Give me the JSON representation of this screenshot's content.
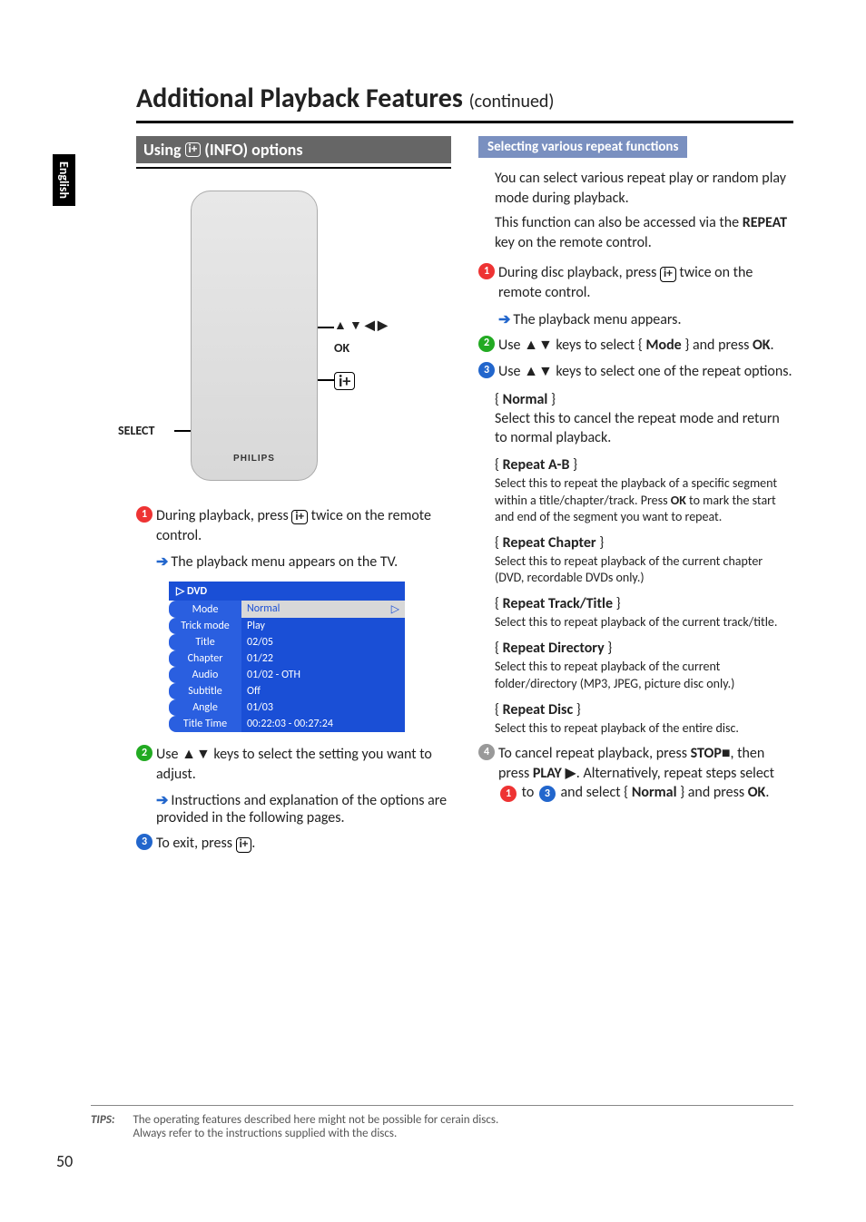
{
  "side_tab": "English",
  "title_main": "Additional Playback Features ",
  "title_cont": "(continued)",
  "left": {
    "section_title": "Using ",
    "section_title_suffix": "(INFO) options",
    "remote_labels": {
      "arrows": "▲ ▼ ◀ ▶",
      "ok": "OK",
      "select": "SELECT"
    },
    "step1": "During playback, press ",
    "step1b": " twice on the remote control.",
    "step1_sub": "The playback menu appears on the TV.",
    "menu_header": "DVD",
    "menu_rows": [
      {
        "label": "Mode",
        "value": "Normal",
        "hi": false,
        "cursor": true
      },
      {
        "label": "Trick mode",
        "value": "Play",
        "hi": true
      },
      {
        "label": "Title",
        "value": "02/05",
        "hi": true
      },
      {
        "label": "Chapter",
        "value": "01/22",
        "hi": true
      },
      {
        "label": "Audio",
        "value": "01/02 - OTH",
        "hi": true
      },
      {
        "label": "Subtitle",
        "value": "Off",
        "hi": true
      },
      {
        "label": "Angle",
        "value": "01/03",
        "hi": true
      },
      {
        "label": "Title Time",
        "value": "00:22:03 - 00:27:24",
        "hi": true
      }
    ],
    "step2": "Use ▲▼ keys to select the setting you want to adjust.",
    "step2_sub": "Instructions and explanation of the options are provided in the following pages.",
    "step3": "To exit, press "
  },
  "right": {
    "box_title": "Selecting various repeat functions",
    "intro1": "You can select various repeat play or random play mode during playback.",
    "intro2a": "This function can also be accessed via the ",
    "intro2b": "REPEAT",
    "intro2c": " key on the remote control.",
    "s1a": "During disc playback, press ",
    "s1b": " twice on the remote control.",
    "s1_sub": "The playback menu appears.",
    "s2a": "Use ▲▼ keys to select { ",
    "s2b": "Mode",
    "s2c": " } and press ",
    "s2d": "OK",
    "s2e": ".",
    "s3": "Use ▲▼ keys to select one of the repeat options.",
    "opts": [
      {
        "head_pre": "{ ",
        "head": "Normal",
        "head_post": " }",
        "desc": "Select this to cancel the repeat mode and return to normal playback.",
        "big": true
      },
      {
        "head_pre": "{ ",
        "head": "Repeat A-B",
        "head_post": " }",
        "desc": "Select this to repeat the playback of a specific segment within a title/chapter/track. Press OK to mark the start and end of the segment you want to repeat."
      },
      {
        "head_pre": "{ ",
        "head": "Repeat Chapter",
        "head_post": " }",
        "desc": "Select this to repeat playback of the current chapter (DVD, recordable DVDs only.)"
      },
      {
        "head_pre": "{ ",
        "head": "Repeat Track/Title",
        "head_post": " }",
        "desc": "Select this to repeat playback of the current track/title."
      },
      {
        "head_pre": "{ ",
        "head": "Repeat Directory",
        "head_post": " }",
        "desc": "Select this to repeat playback of the current folder/directory (MP3, JPEG, picture disc only.)"
      },
      {
        "head_pre": "{ ",
        "head": "Repeat Disc",
        "head_post": " }",
        "desc": "Select this to repeat playback of the entire disc."
      }
    ],
    "s4_parts": {
      "a": "To cancel repeat playback, press ",
      "b": "STOP",
      "c": "■, then press ",
      "d": "PLAY",
      "e": " ▶. Alternatively, repeat steps select ",
      "f": " to ",
      "g": " and select { ",
      "h": "Normal",
      "i": " } and press ",
      "j": "OK",
      "k": "."
    }
  },
  "tips": {
    "label": "TIPS:",
    "line1": "The operating features described here might not be possible for cerain discs.",
    "line2": "Always refer to the instructions supplied with the discs."
  },
  "page_number": "50",
  "remote_brand": "PHILIPS"
}
